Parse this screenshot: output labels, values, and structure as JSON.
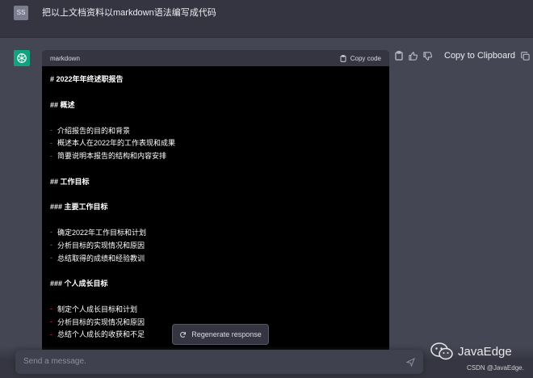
{
  "user": {
    "avatar_text": "SS",
    "message": "把以上文档资料以markdown语法编写成代码"
  },
  "code_block": {
    "language": "markdown",
    "copy_label": "Copy code",
    "lines": [
      {
        "type": "h",
        "text": "# 2022年年终述职报告"
      },
      {
        "type": "blank",
        "text": ""
      },
      {
        "type": "h",
        "text": "## 概述"
      },
      {
        "type": "blank",
        "text": ""
      },
      {
        "type": "li",
        "text": "介绍报告的目的和背景"
      },
      {
        "type": "li",
        "text": "概述本人在2022年的工作表现和成果"
      },
      {
        "type": "li",
        "text": "简要说明本报告的结构和内容安排"
      },
      {
        "type": "blank",
        "text": ""
      },
      {
        "type": "h",
        "text": "## 工作目标"
      },
      {
        "type": "blank",
        "text": ""
      },
      {
        "type": "h",
        "text": "### 主要工作目标"
      },
      {
        "type": "blank",
        "text": ""
      },
      {
        "type": "li",
        "text": "确定2022年工作目标和计划"
      },
      {
        "type": "li",
        "text": "分析目标的实现情况和原因"
      },
      {
        "type": "li",
        "text": "总结取得的成绩和经验教训"
      },
      {
        "type": "blank",
        "text": ""
      },
      {
        "type": "h",
        "text": "### 个人成长目标"
      },
      {
        "type": "blank",
        "text": ""
      },
      {
        "type": "li",
        "text": "制定个人成长目标和计划"
      },
      {
        "type": "li",
        "text": "分析目标的实现情况和原因"
      },
      {
        "type": "li",
        "text": "总结个人成长的收获和不足"
      }
    ]
  },
  "side": {
    "copy_clipboard_label": "Copy to Clipboard"
  },
  "regenerate_label": "Regenerate response",
  "input": {
    "placeholder": "Send a message."
  },
  "brand": {
    "name": "JavaEdge",
    "credit": "CSDN @JavaEdge."
  },
  "colors": {
    "bullet": "#ef4146",
    "accent": "#10a37f"
  }
}
